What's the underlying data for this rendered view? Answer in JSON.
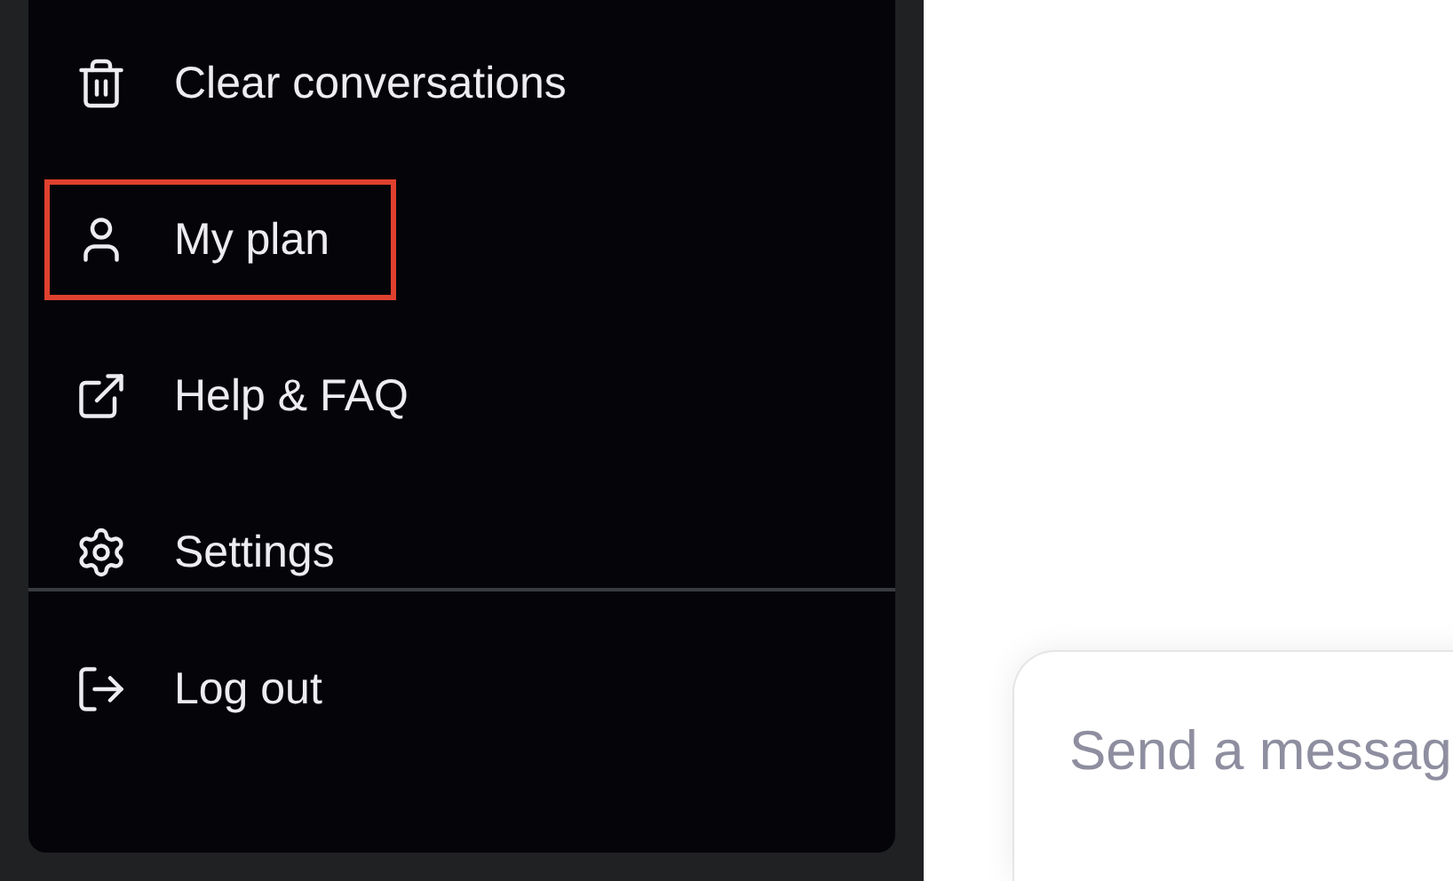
{
  "menu": {
    "items": [
      {
        "kind": "trash",
        "label": "Clear conversations",
        "highlighted": false
      },
      {
        "kind": "user",
        "label": "My plan",
        "highlighted": true
      },
      {
        "kind": "external",
        "label": "Help & FAQ",
        "highlighted": false
      },
      {
        "kind": "settings",
        "label": "Settings",
        "highlighted": false
      }
    ],
    "footer_items": [
      {
        "kind": "logout",
        "label": "Log out",
        "highlighted": false
      }
    ]
  },
  "composer": {
    "placeholder": "Send a messag"
  }
}
